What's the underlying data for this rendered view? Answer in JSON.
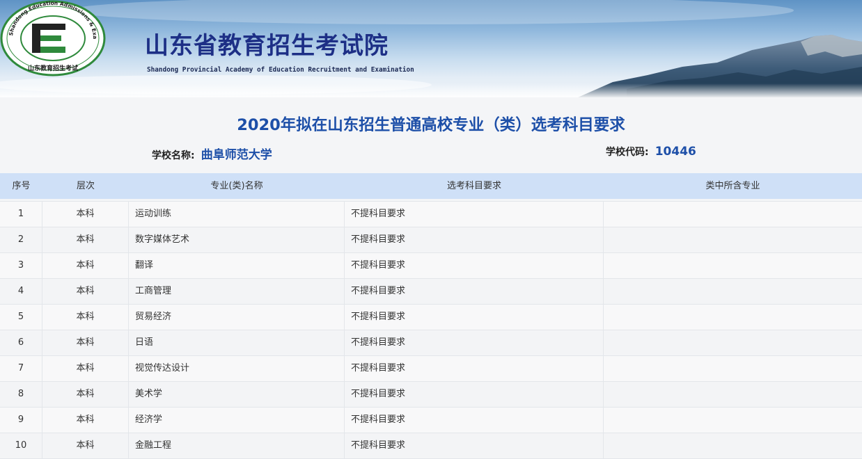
{
  "banner": {
    "title_cn": "山东省教育招生考试院",
    "title_en": "Shandong Provincial Academy of Education  Recruitment and Examination",
    "logo_ring_text": "Shandong Education Admissions & Examinations",
    "logo_cn_text": "山东教育招生考试"
  },
  "page": {
    "title": "2020年拟在山东招生普通高校专业（类）选考科目要求",
    "school_name_label": "学校名称:",
    "school_name": "曲阜师范大学",
    "school_code_label": "学校代码:",
    "school_code": "10446"
  },
  "table": {
    "headers": [
      "序号",
      "层次",
      "专业(类)名称",
      "选考科目要求",
      "类中所含专业"
    ],
    "rows": [
      {
        "no": "1",
        "level": "本科",
        "major": "运动训练",
        "req": "不提科目要求",
        "included": ""
      },
      {
        "no": "2",
        "level": "本科",
        "major": "数字媒体艺术",
        "req": "不提科目要求",
        "included": ""
      },
      {
        "no": "3",
        "level": "本科",
        "major": "翻译",
        "req": "不提科目要求",
        "included": ""
      },
      {
        "no": "4",
        "level": "本科",
        "major": "工商管理",
        "req": "不提科目要求",
        "included": ""
      },
      {
        "no": "5",
        "level": "本科",
        "major": "贸易经济",
        "req": "不提科目要求",
        "included": ""
      },
      {
        "no": "6",
        "level": "本科",
        "major": "日语",
        "req": "不提科目要求",
        "included": ""
      },
      {
        "no": "7",
        "level": "本科",
        "major": "视觉传达设计",
        "req": "不提科目要求",
        "included": ""
      },
      {
        "no": "8",
        "level": "本科",
        "major": "美术学",
        "req": "不提科目要求",
        "included": ""
      },
      {
        "no": "9",
        "level": "本科",
        "major": "经济学",
        "req": "不提科目要求",
        "included": ""
      },
      {
        "no": "10",
        "level": "本科",
        "major": "金融工程",
        "req": "不提科目要求",
        "included": ""
      }
    ]
  },
  "colors": {
    "brand_blue": "#1d4fa8",
    "banner_title": "#1d2f86",
    "header_bg": "#cfe0f7",
    "logo_green": "#2f8a3c"
  }
}
